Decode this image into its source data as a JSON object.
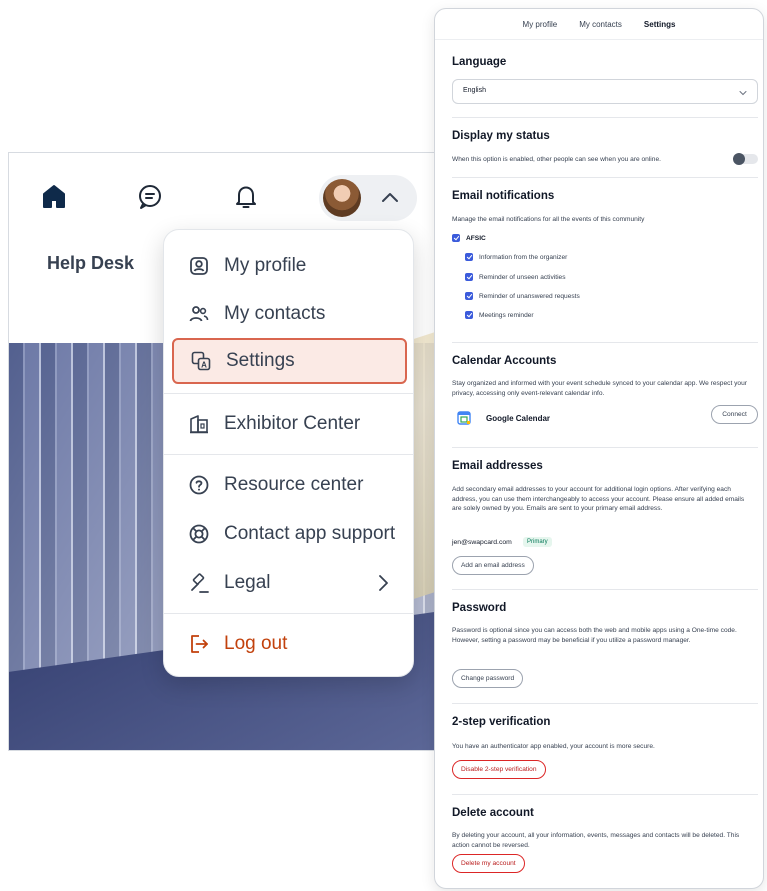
{
  "app": {
    "nav": {
      "home_icon": "home-icon",
      "chat_icon": "chat-icon",
      "bell_icon": "bell-icon",
      "avatar_chevron": "chevron-up-icon"
    },
    "help_desk_label": "Help Desk"
  },
  "user_menu": {
    "items": [
      {
        "label": "My profile",
        "icon": "profile-icon"
      },
      {
        "label": "My contacts",
        "icon": "contacts-icon"
      },
      {
        "label": "Settings",
        "icon": "translate-icon",
        "selected": true
      },
      {
        "label": "Exhibitor Center",
        "icon": "building-icon"
      },
      {
        "label": "Resource center",
        "icon": "help-circle-icon"
      },
      {
        "label": "Contact app support",
        "icon": "lifebuoy-icon"
      },
      {
        "label": "Legal",
        "icon": "gavel-icon"
      },
      {
        "label": "Log out",
        "icon": "logout-icon"
      }
    ],
    "accent_color": "#d9664f"
  },
  "settings": {
    "tabs": [
      {
        "label": "My profile"
      },
      {
        "label": "My contacts"
      },
      {
        "label": "Settings",
        "active": true
      }
    ],
    "language": {
      "title": "Language",
      "value": "English"
    },
    "status": {
      "title": "Display my status",
      "description": "When this option is enabled, other people can see when you are online.",
      "enabled": false
    },
    "email_notifications": {
      "title": "Email notifications",
      "description": "Manage the email notifications for all the events of this community",
      "community": "AFSIC",
      "options": [
        "Information from the organizer",
        "Reminder of unseen activities",
        "Reminder of unanswered requests",
        "Meetings reminder"
      ]
    },
    "calendar": {
      "title": "Calendar Accounts",
      "description": "Stay organized and informed with your event schedule synced to your calendar app. We respect your privacy, accessing only event-relevant calendar info.",
      "provider": "Google Calendar",
      "connect_label": "Connect"
    },
    "emails": {
      "title": "Email addresses",
      "description": "Add secondary email addresses to your account for additional login options. After verifying each address, you can use them interchangeably to access your account. Please ensure all added emails are solely owned by you. Emails are sent to your primary email address.",
      "address": "jen@swapcard.com",
      "badge": "Primary",
      "add_label": "Add an email address"
    },
    "password": {
      "title": "Password",
      "description": "Password is optional since you can access both the web and mobile apps using a One-time code. However, setting a password may be beneficial if you utilize a password manager.",
      "change_label": "Change password"
    },
    "two_step": {
      "title": "2-step verification",
      "description": "You have an authenticator app enabled, your account is more secure.",
      "disable_label": "Disable 2-step verification"
    },
    "delete": {
      "title": "Delete account",
      "description": "By deleting your account, all your information, events, messages and contacts will be deleted. This action cannot be reversed.",
      "delete_label": "Delete my account"
    }
  }
}
